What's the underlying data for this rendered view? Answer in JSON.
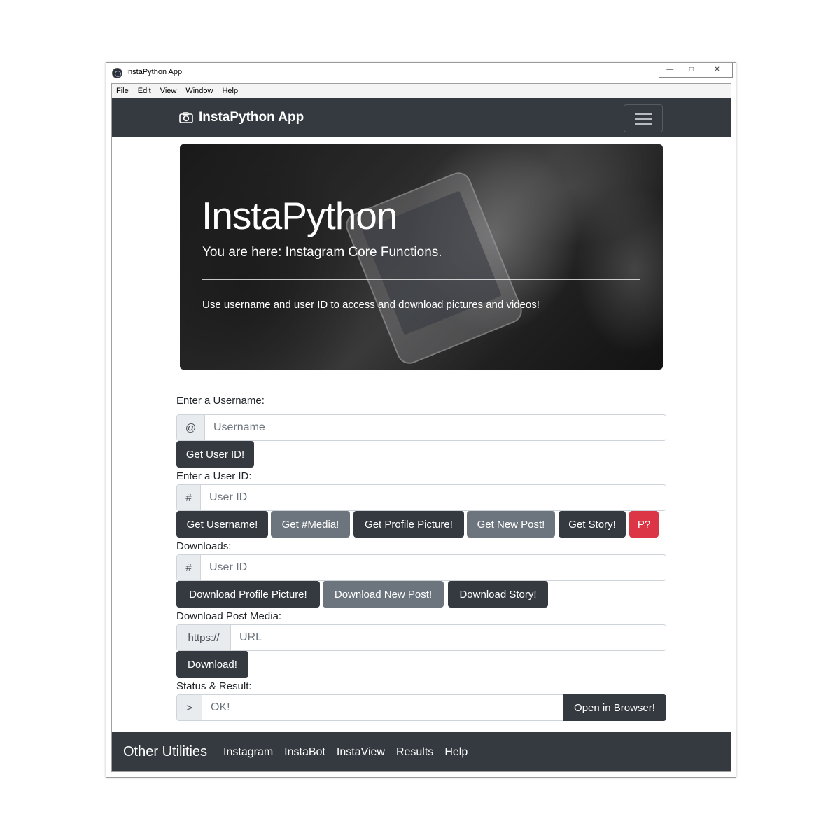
{
  "window": {
    "title": "InstaPython App",
    "controls": {
      "minimize": "—",
      "maximize": "□",
      "close": "✕"
    }
  },
  "menu": [
    "File",
    "Edit",
    "View",
    "Window",
    "Help"
  ],
  "navbar": {
    "brand": "InstaPython App",
    "brand_icon": "camera-icon",
    "toggler_icon": "hamburger-icon"
  },
  "jumbotron": {
    "title": "InstaPython",
    "lead": "You are here: Instagram Core Functions.",
    "text": "Use username and user ID to access and download pictures and videos!"
  },
  "username_section": {
    "label": "Enter a Username:",
    "addon": "@",
    "placeholder": "Username",
    "button": "Get User ID!"
  },
  "userid_section": {
    "label": "Enter a User ID:",
    "addon": "#",
    "placeholder": "User ID",
    "buttons": [
      "Get Username!",
      "Get #Media!",
      "Get Profile Picture!",
      "Get New Post!",
      "Get Story!",
      "P?"
    ]
  },
  "downloads_section": {
    "label": "Downloads:",
    "addon": "#",
    "placeholder": "User ID",
    "buttons": [
      "Download Profile Picture!",
      "Download New Post!",
      "Download Story!"
    ]
  },
  "post_media_section": {
    "label": "Download Post Media:",
    "addon": "https://",
    "placeholder": "URL",
    "button": "Download!"
  },
  "status_section": {
    "label": "Status & Result:",
    "addon": ">",
    "placeholder": "OK!",
    "button": "Open in Browser!"
  },
  "footer": {
    "brand": "Other Utilities",
    "links": [
      "Instagram",
      "InstaBot",
      "InstaView",
      "Results",
      "Help"
    ]
  },
  "colors": {
    "dark": "#343a40",
    "secondary": "#6c757d",
    "danger": "#dc3545"
  }
}
